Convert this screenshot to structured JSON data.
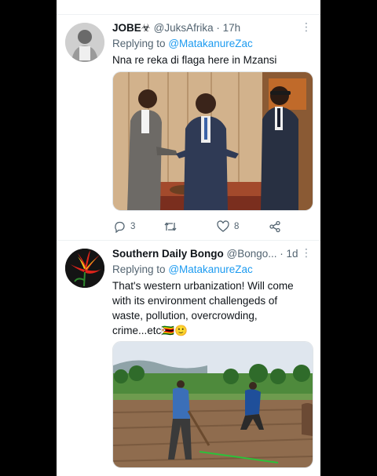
{
  "tweets": [
    {
      "name": "JOBE",
      "name_emoji": "☣",
      "handle": "@JuksAfrika",
      "dot": "·",
      "time": "17h",
      "replying_label": "Replying to",
      "replying_handle": "@MatakanureZac",
      "text": "Nna re reka di flaga here in Mzansi",
      "replies": "3",
      "retweets": "",
      "likes": "8",
      "media_icon": "photo-three-men-in-suits"
    },
    {
      "name": "Southern Daily Bongo",
      "handle": "@Bongo...",
      "dot": "·",
      "time": "1d",
      "replying_label": "Replying to",
      "replying_handle": "@MatakanureZac",
      "text": "That's western urbanization! Will come with its environment challengeds of waste, pollution, overcrowding, crime...etc",
      "text_emojis": "🇿🇼🙂",
      "media_icon": "photo-farmers-ploughing-field"
    }
  ],
  "colors": {
    "link": "#1d9bf0",
    "muted": "#536471",
    "text": "#0f1419",
    "background": "#000000"
  },
  "icons": [
    "more-icon",
    "reply-icon",
    "retweet-icon",
    "like-icon",
    "share-icon"
  ]
}
